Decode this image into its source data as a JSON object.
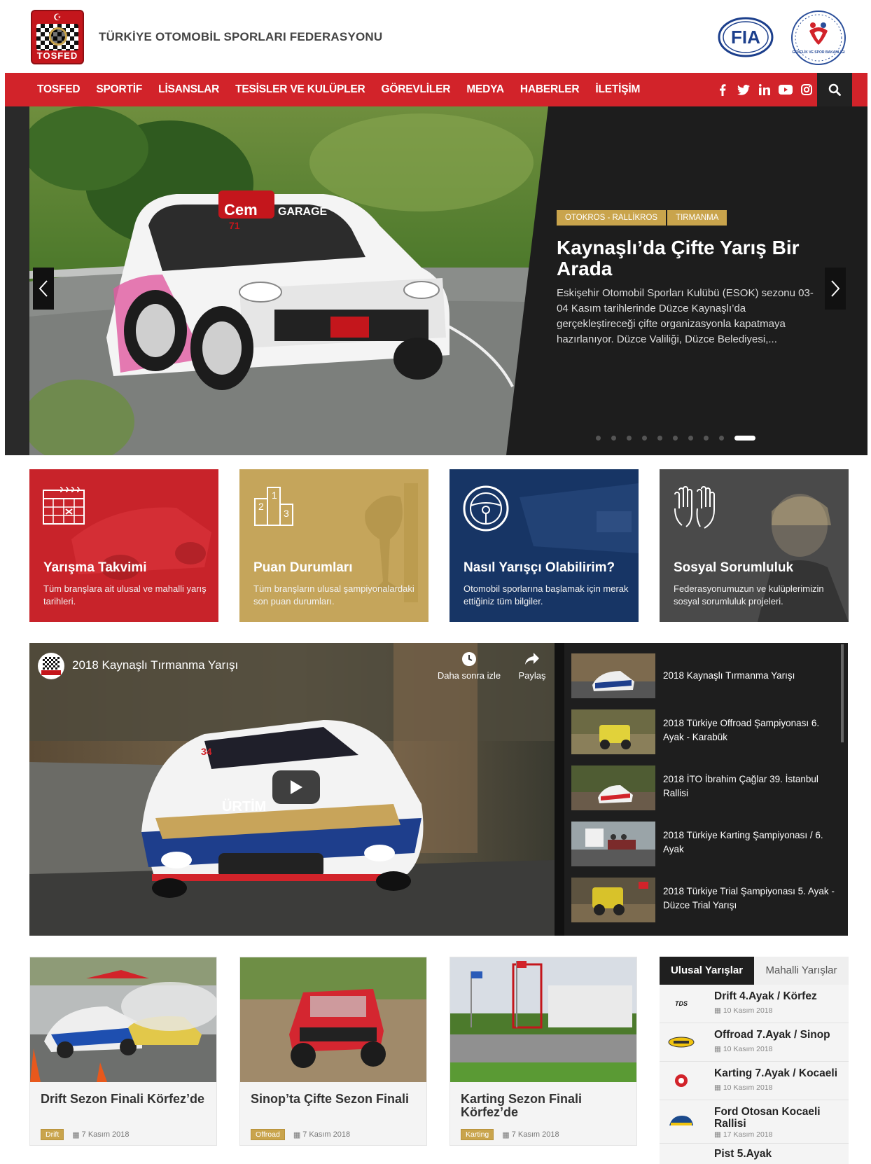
{
  "header": {
    "logo_text": "TOSFED",
    "federation_title": "TÜRKİYE OTOMOBİL SPORLARI FEDERASYONU",
    "fia_logo_text": "FIA",
    "ministry_logo_text": "GENÇLİK VE SPOR BAKANLIĞI"
  },
  "nav": {
    "items": [
      "TOSFED",
      "SPORTİF",
      "LİSANSLAR",
      "TESİSLER VE KULÜPLER",
      "GÖREVLİLER",
      "MEDYA",
      "HABERLER",
      "İLETİŞİM"
    ],
    "social_icons": [
      "facebook-icon",
      "twitter-icon",
      "linkedin-icon",
      "youtube-icon",
      "instagram-icon"
    ],
    "search_icon": "search-icon"
  },
  "hero": {
    "tags": [
      "OTOKROS - RALLİKROS",
      "TIRMANMA"
    ],
    "title": "Kaynaşlı’da Çifte Yarış Bir Arada",
    "text": "Eskişehir Otomobil Sporları Kulübü (ESOK) sezonu 03-04 Kasım tarihlerinde Düzce Kaynaşlı’da gerçekleştireceği çifte organizasyonla kapatmaya hazırlanıyor. Düzce Valiliği, Düzce Belediyesi,...",
    "car_text_1": "Cem",
    "car_text_2": "GARAGE",
    "car_number": "71",
    "slide_count": 10,
    "active_slide": 10
  },
  "features": [
    {
      "title": "Yarışma Takvimi",
      "desc": "Tüm branşlara ait ulusal ve mahalli yarış tarihleri.",
      "color": "#c8232a"
    },
    {
      "title": "Puan Durumları",
      "desc": "Tüm branşların ulusal şampiyonalardaki son puan durumları.",
      "color": "#c5a55b"
    },
    {
      "title": "Nasıl Yarışçı Olabilirim?",
      "desc": "Otomobil sporlarına başlamak için merak ettiğiniz tüm bilgiler.",
      "color": "#173565"
    },
    {
      "title": "Sosyal Sorumluluk",
      "desc": "Federasyonumuzun ve kulüplerimizin sosyal sorumluluk projeleri.",
      "color": "#4a4a4a"
    }
  ],
  "video": {
    "title": "2018 Kaynaşlı Tırmanma Yarışı",
    "watch_later": "Daha sonra izle",
    "share": "Paylaş",
    "car_brand": "ÜRTİM",
    "car_number": "34"
  },
  "playlist": [
    "2018 Kaynaşlı Tırmanma Yarışı",
    "2018 Türkiye Offroad Şampiyonası 6. Ayak - Karabük",
    "2018 İTO İbrahim Çağlar 39. İstanbul Rallisi",
    "2018 Türkiye Karting Şampiyonası / 6. Ayak",
    "2018 Türkiye Trial Şampiyonası 5. Ayak - Düzce Trial Yarışı"
  ],
  "news": [
    {
      "title": "Drift Sezon Finali Körfez’de",
      "category": "Drift",
      "date": "7 Kasım 2018"
    },
    {
      "title": "Sinop’ta Çifte Sezon Finali",
      "category": "Offroad",
      "date": "7 Kasım 2018"
    },
    {
      "title": "Karting Sezon Finali Körfez’de",
      "category": "Karting",
      "date": "7 Kasım 2018"
    }
  ],
  "races": {
    "tabs": [
      "Ulusal Yarışlar",
      "Mahalli Yarışlar"
    ],
    "items": [
      {
        "name": "Drift 4.Ayak / Körfez",
        "date": "10 Kasım 2018",
        "logo": "TDS"
      },
      {
        "name": "Offroad 7.Ayak / Sinop",
        "date": "10 Kasım 2018",
        "logo": ""
      },
      {
        "name": "Karting 7.Ayak / Kocaeli",
        "date": "10 Kasım 2018",
        "logo": ""
      },
      {
        "name": "Ford Otosan Kocaeli Rallisi",
        "date": "17 Kasım 2018",
        "logo": ""
      },
      {
        "name": "Pist 5.Ayak",
        "date": "",
        "logo": ""
      }
    ]
  }
}
